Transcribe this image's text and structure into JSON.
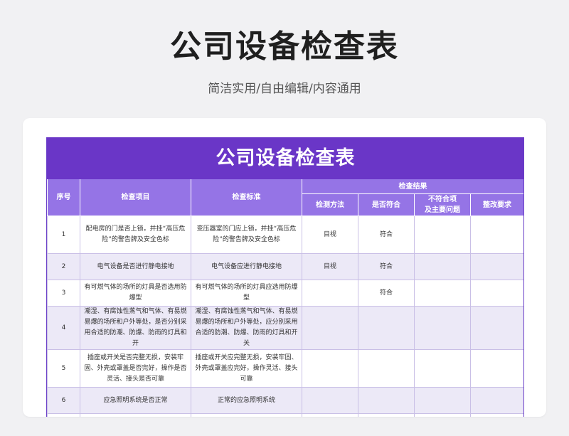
{
  "page": {
    "title": "公司设备检查表",
    "subtitle": "简洁实用/自由编辑/内容通用"
  },
  "table": {
    "title": "公司设备检查表",
    "headers": {
      "seq": "序号",
      "item": "检查项目",
      "standard": "检查标准",
      "result_group": "检查结果",
      "method": "检测方法",
      "conform": "是否符合",
      "nonconform_line1": "不符合项",
      "nonconform_line2": "及主要问题",
      "rectify": "整改要求"
    },
    "rows": [
      {
        "seq": "1",
        "item": "配电房的门是否上锁，并挂“高压危险”的警告牌及安全色标",
        "standard": "变压器室的门应上锁，并挂“高压危险”的警告牌及安全色标",
        "method": "目视",
        "conform": "符合",
        "nonconform": "",
        "rectify": ""
      },
      {
        "seq": "2",
        "item": "电气设备是否进行静电接地",
        "standard": "电气设备应进行静电接地",
        "method": "目视",
        "conform": "符合",
        "nonconform": "",
        "rectify": ""
      },
      {
        "seq": "3",
        "item": "有可燃气体的场所的灯具是否选用防爆型",
        "standard": "有可燃气体的场所的灯具应选用防爆型",
        "method": "",
        "conform": "符合",
        "nonconform": "",
        "rectify": ""
      },
      {
        "seq": "4",
        "item": "潮湿、有腐蚀性蒸气和气体、有易燃易爆的场所和户外等处，是否分别采用合适的防潮、防爆、防雨的灯具和开",
        "standard": "潮湿、有腐蚀性蒸气和气体、有易燃易爆的场所和户外等处，应分别采用合适的防潮、防爆、防雨的灯具和开关",
        "method": "",
        "conform": "",
        "nonconform": "",
        "rectify": ""
      },
      {
        "seq": "5",
        "item": "插座或开关是否完整无损，安装牢固、外壳或罩盖是否完好，操作是否灵活、接头是否可靠",
        "standard": "插座或开关应完整无损，安装牢固、外壳或罩盖应完好，操作灵活、接头可靠",
        "method": "",
        "conform": "",
        "nonconform": "",
        "rectify": ""
      },
      {
        "seq": "6",
        "item": "应急照明系统是否正常",
        "standard": "正常的应急照明系统",
        "method": "",
        "conform": "",
        "nonconform": "",
        "rectify": ""
      },
      {
        "seq": "",
        "item": "",
        "standard": "",
        "method": "",
        "conform": "",
        "nonconform": "",
        "rectify": ""
      }
    ]
  }
}
